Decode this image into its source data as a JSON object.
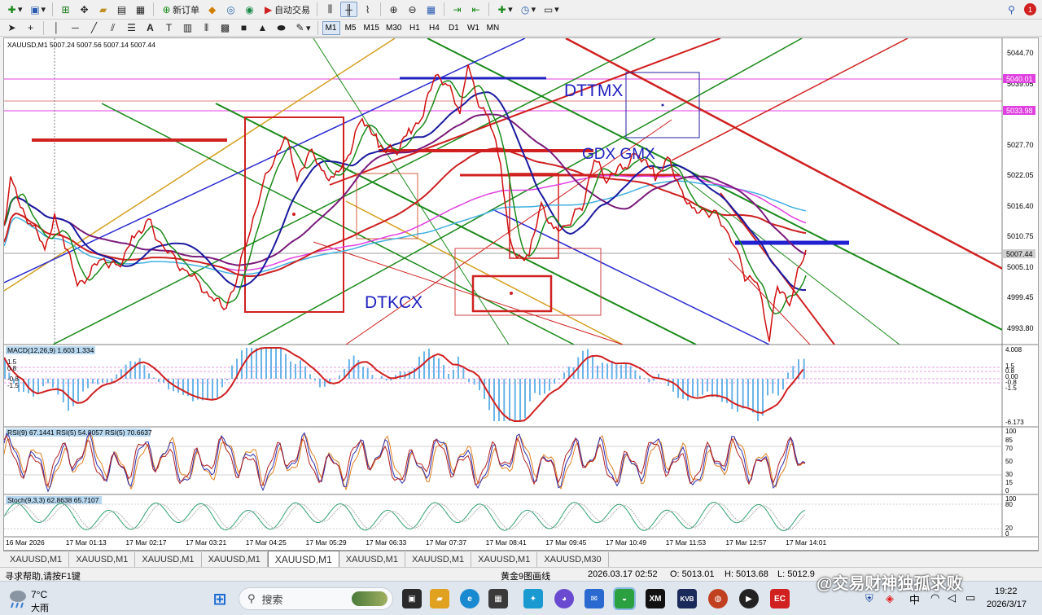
{
  "toolbar": {
    "new_order": "新订单",
    "auto_trade": "自动交易",
    "timeframes": [
      "M1",
      "M5",
      "M15",
      "M30",
      "H1",
      "H4",
      "D1",
      "W1",
      "MN"
    ],
    "active_timeframe": "M1"
  },
  "chart": {
    "symbol_header": "XAUUSD,M1  5007.24 5007.56 5007.14 5007.44",
    "price_labels": [
      "5044.70",
      "5039.05",
      "5033.98",
      "5027.70",
      "5022.05",
      "5016.40",
      "5010.75",
      "5005.10",
      "4999.45",
      "4993.80"
    ],
    "tag_5040": "5040.01",
    "tag_5033": "5033.98",
    "tag_current": "5007.44",
    "annotations": {
      "dttmx": "DTTMX",
      "gdx_gmx": "GDX GMX",
      "dtkcx": "DTKCX"
    },
    "time_labels": [
      "16 Mar 2026",
      "17 Mar 01:13",
      "17 Mar 02:17",
      "17 Mar 03:21",
      "17 Mar 04:25",
      "17 Mar 05:29",
      "17 Mar 06:33",
      "17 Mar 07:37",
      "17 Mar 08:41",
      "17 Mar 09:45",
      "17 Mar 10:49",
      "17 Mar 11:53",
      "17 Mar 12:57",
      "17 Mar 14:01"
    ],
    "macd": {
      "header": "MACD(12,26,9) 1.603 1.334",
      "scale": [
        "4.008",
        "1.5",
        "0.8",
        "0.00",
        "-0.8",
        "-1.5",
        "-6.173"
      ],
      "left_scale": [
        "1.5",
        "0.8",
        "-0.8",
        "-1.5"
      ]
    },
    "rsi": {
      "header": "RSI(9) 67.1441  RSI(5) 54.8057  RSI(5) 70.6637",
      "scale": [
        "100",
        "85",
        "70",
        "50",
        "30",
        "15",
        "0"
      ]
    },
    "stoch": {
      "header": "Stoch(9,3,3) 62.8638 65.7107",
      "scale": [
        "100",
        "80",
        "20",
        "0"
      ]
    },
    "colors": {
      "candle_red": "#d01010",
      "ma_blue": "#1a1aa0",
      "ma_purple": "#7a1a7a",
      "ma_red": "#cc2020",
      "ma_magenta": "#e040e0",
      "ma_cyan": "#40b0e0",
      "channel_green": "#1a8a1a",
      "channel_blue": "#2a2ad0",
      "channel_gold": "#d4a020",
      "annot_blue": "#2020c0"
    }
  },
  "tabs": [
    "XAUUSD,M1",
    "XAUUSD,M1",
    "XAUUSD,M1",
    "XAUUSD,M1",
    "XAUUSD,M1",
    "XAUUSD,M1",
    "XAUUSD,M1",
    "XAUUSD,M1",
    "XAUUSD,M30"
  ],
  "active_tab": 4,
  "status": {
    "help": "寻求帮助,请按F1键",
    "profile": "黄金9图画线",
    "datetime": "2026.03.17 02:52",
    "open": "O: 5013.01",
    "high": "H: 5013.68",
    "low": "L: 5012.9"
  },
  "taskbar": {
    "weather_temp": "7°C",
    "weather_desc": "大雨",
    "search_placeholder": "搜索",
    "app_xm": "XM",
    "app_kvb": "KVB",
    "app_ec": "EC",
    "tray_lang": "中",
    "time": "19:22",
    "date": "2026/3/17",
    "notif_count": "1"
  },
  "watermark": "@交易财神独孤求败"
}
